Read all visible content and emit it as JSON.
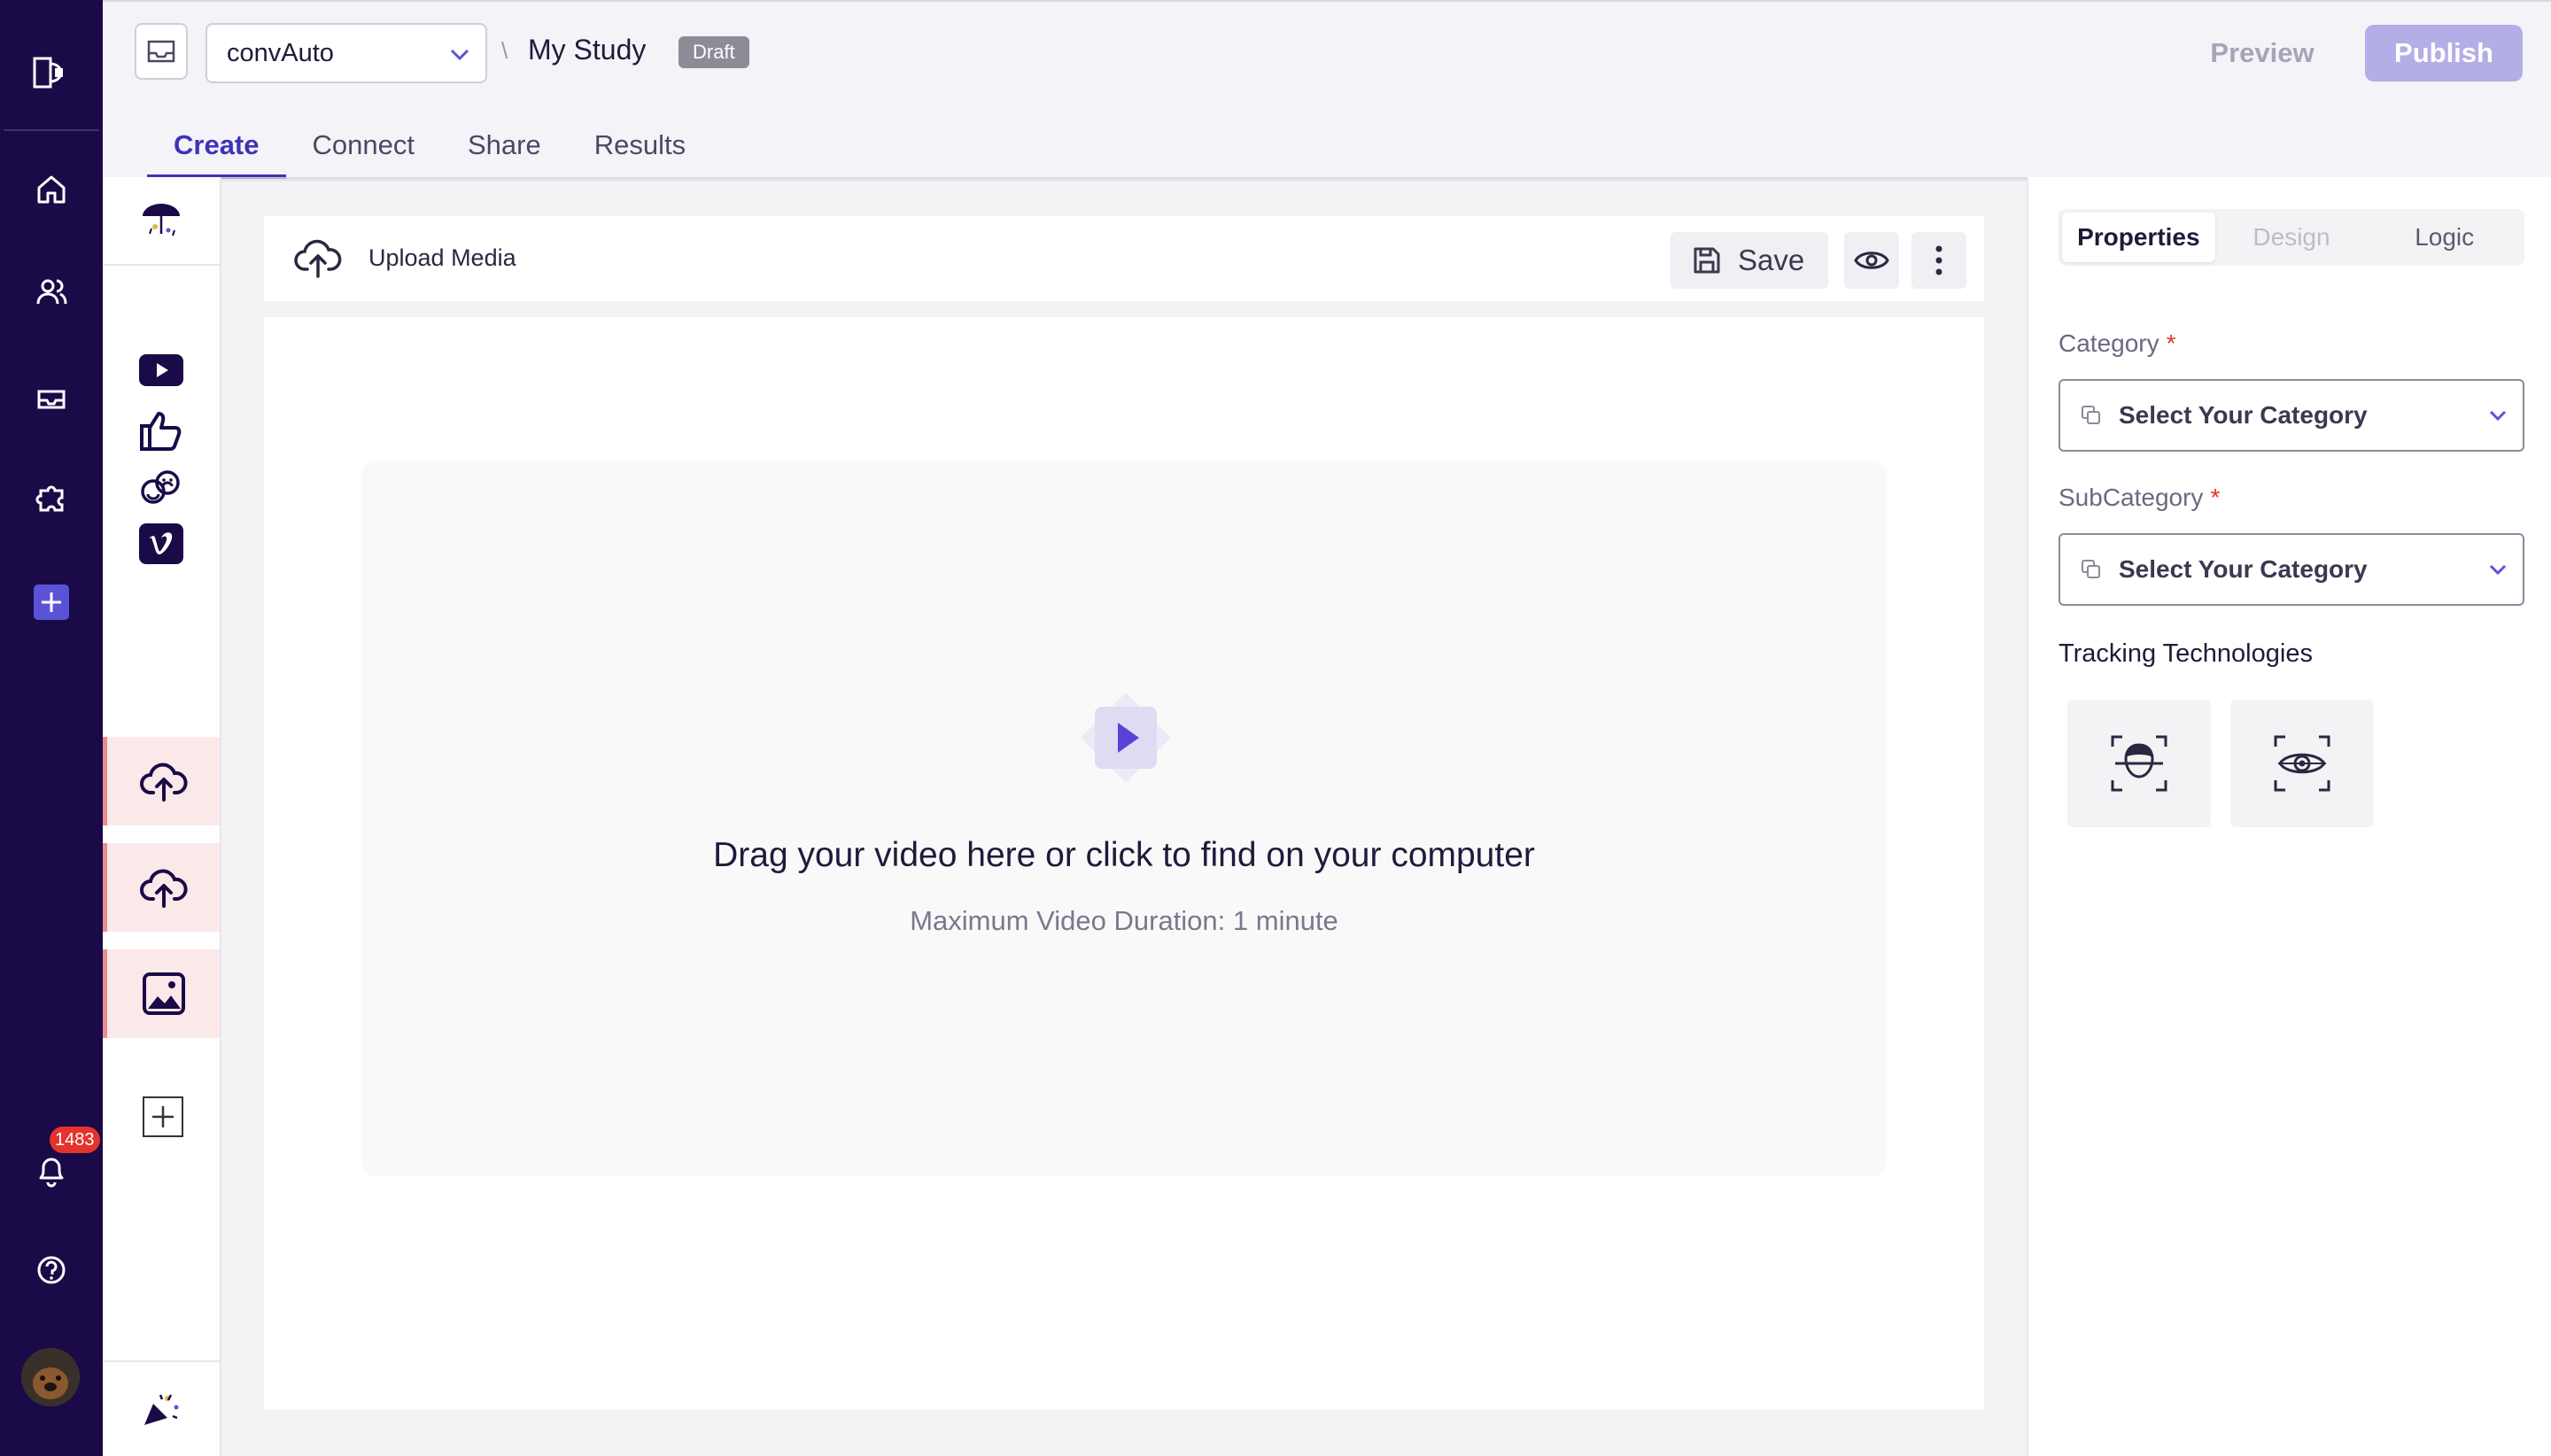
{
  "workspace": {
    "name": "convAuto"
  },
  "breadcrumb": {
    "separator": "\\",
    "study_title": "My Study",
    "status_badge": "Draft"
  },
  "header": {
    "preview_label": "Preview",
    "publish_label": "Publish"
  },
  "tabs": [
    {
      "label": "Create",
      "active": true
    },
    {
      "label": "Connect",
      "active": false
    },
    {
      "label": "Share",
      "active": false
    },
    {
      "label": "Results",
      "active": false
    }
  ],
  "leftnav": {
    "items": [
      "home-icon",
      "users-icon",
      "inbox-icon",
      "puzzle-icon",
      "add-icon",
      "bell-icon",
      "help-icon"
    ],
    "notification_count": "1483"
  },
  "rail": {
    "items": [
      {
        "icon": "youtube-icon",
        "error": false
      },
      {
        "icon": "thumbs-up-icon",
        "error": false
      },
      {
        "icon": "emotions-icon",
        "error": false
      },
      {
        "icon": "vimeo-icon",
        "error": false
      },
      {
        "icon": "upload-icon",
        "error": true
      },
      {
        "icon": "upload-icon",
        "error": true
      },
      {
        "icon": "image-icon",
        "error": true
      }
    ]
  },
  "toolbar": {
    "upload_label": "Upload Media",
    "save_label": "Save"
  },
  "dropzone": {
    "title": "Drag your video here or click to find on your computer",
    "subtitle": "Maximum Video Duration: 1 minute"
  },
  "panel": {
    "tabs": [
      {
        "label": "Properties",
        "state": "active"
      },
      {
        "label": "Design",
        "state": "disabled"
      },
      {
        "label": "Logic",
        "state": "normal"
      }
    ],
    "category_label": "Category",
    "category_placeholder": "Select Your Category",
    "subcategory_label": "SubCategory",
    "subcategory_placeholder": "Select Your Category",
    "required_mark": "*",
    "tracking_label": "Tracking Technologies",
    "tracking_options": [
      "face-tracking-icon",
      "eye-tracking-icon"
    ]
  },
  "colors": {
    "nav_bg": "#1a0a47",
    "accent": "#3d32b8",
    "publish_disabled": "#b3aee6",
    "error_bg": "#fbe9ea",
    "required": "#e4332c"
  }
}
